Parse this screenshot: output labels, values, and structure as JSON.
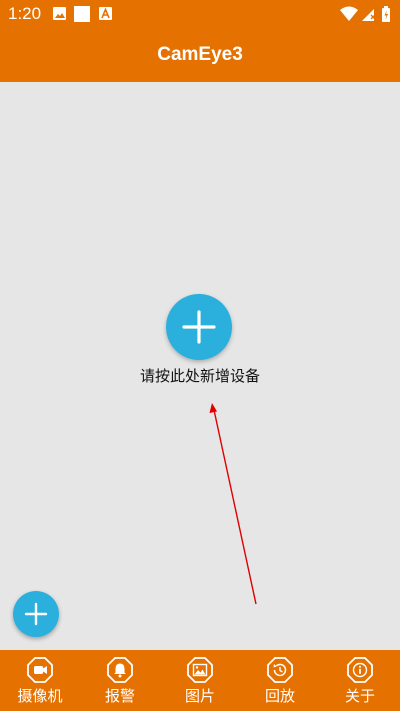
{
  "status_bar": {
    "time": "1:20",
    "left_icons": [
      "image-icon",
      "square-icon",
      "a-badge-icon"
    ],
    "right_icons": [
      "wifi-icon",
      "signal-icon",
      "battery-icon"
    ]
  },
  "app_bar": {
    "title": "CamEye3"
  },
  "main": {
    "center_button_icon": "plus-icon",
    "hint": "请按此处新增设备"
  },
  "fab": {
    "icon": "plus-icon"
  },
  "bottom_nav": {
    "items": [
      {
        "label": "摄像机",
        "icon": "camera-icon"
      },
      {
        "label": "报警",
        "icon": "bell-icon"
      },
      {
        "label": "图片",
        "icon": "picture-icon"
      },
      {
        "label": "回放",
        "icon": "playback-icon"
      },
      {
        "label": "关于",
        "icon": "info-icon"
      }
    ]
  },
  "colors": {
    "primary": "#e57200",
    "accent": "#2bb0de",
    "background": "#e6e6e6",
    "annotation_arrow": "#e00000"
  }
}
